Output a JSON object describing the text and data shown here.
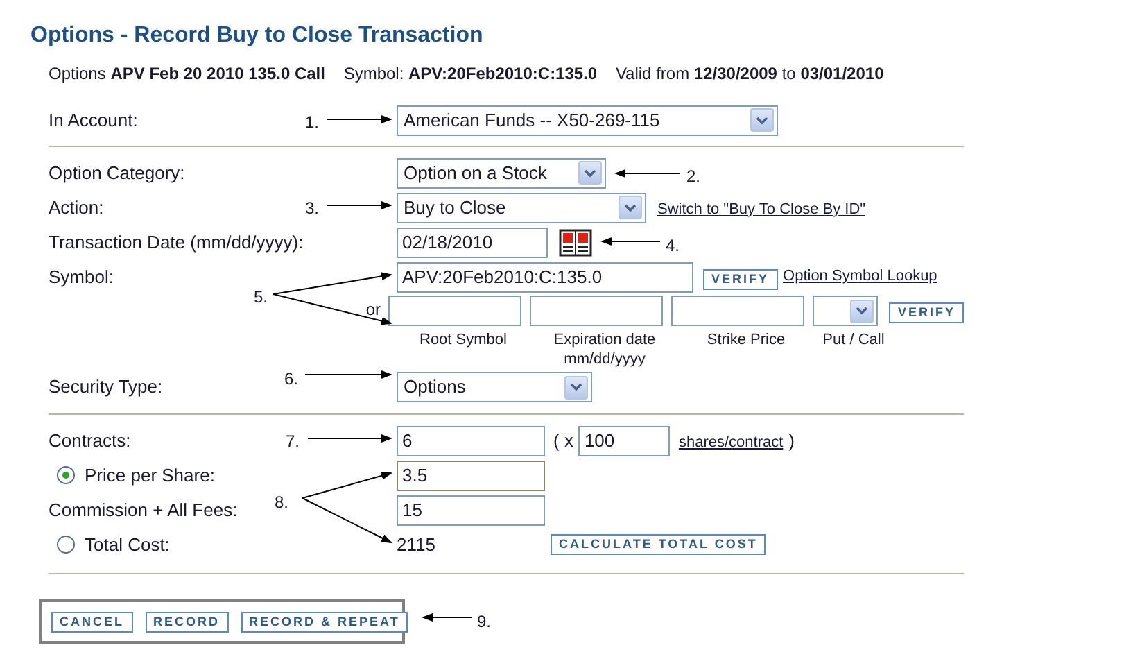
{
  "title": "Options - Record Buy to Close Transaction",
  "summary": {
    "prefix": "Options",
    "option": "APV Feb 20 2010 135.0 Call",
    "symbol_label": "Symbol:",
    "symbol": "APV:20Feb2010:C:135.0",
    "valid_label": "Valid from",
    "valid_from": "12/30/2009",
    "to_label": "to",
    "valid_to": "03/01/2010"
  },
  "account": {
    "label": "In Account:",
    "value": "American Funds -- X50-269-115"
  },
  "option_category": {
    "label": "Option Category:",
    "value": "Option on a Stock"
  },
  "action": {
    "label": "Action:",
    "value": "Buy to Close",
    "link": "Switch to \"Buy To Close By ID\""
  },
  "transaction_date": {
    "label": "Transaction Date (mm/dd/yyyy):",
    "value": "02/18/2010"
  },
  "symbol": {
    "label": "Symbol:",
    "value": "APV:20Feb2010:C:135.0",
    "verify": "VERIFY",
    "lookup": "Option Symbol Lookup",
    "or": "or",
    "captions": [
      "Root Symbol",
      "Expiration date mm/dd/yyyy",
      "Strike Price",
      "Put / Call"
    ],
    "verify2": "VERIFY"
  },
  "security_type": {
    "label": "Security Type:",
    "value": "Options"
  },
  "contracts": {
    "label": "Contracts:",
    "value": "6",
    "open": "( x",
    "shares": "100",
    "link": "shares/contract",
    "close": ")"
  },
  "price": {
    "label": "Price per Share:",
    "value": "3.5",
    "selected": true
  },
  "commission": {
    "label": "Commission + All Fees:",
    "value": "15"
  },
  "total": {
    "label": "Total Cost:",
    "value": "2115",
    "selected": false,
    "button": "CALCULATE TOTAL COST"
  },
  "buttons": [
    "CANCEL",
    "RECORD",
    "RECORD & REPEAT"
  ],
  "annotations": [
    "1.",
    "2.",
    "3.",
    "4.",
    "5.",
    "6.",
    "7.",
    "8.",
    "9."
  ]
}
